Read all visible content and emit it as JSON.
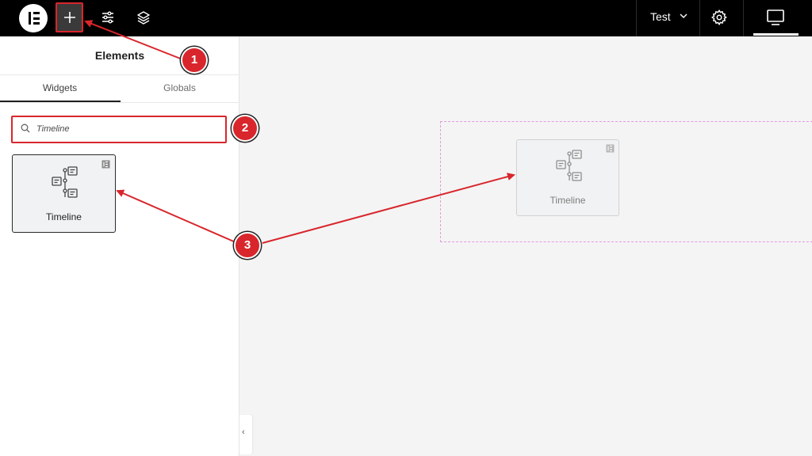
{
  "topbar": {
    "page_name": "Test",
    "icons": [
      "elementor-logo",
      "plus-icon",
      "sliders-icon",
      "layers-icon",
      "chevron-down-icon",
      "gear-icon",
      "desktop-icon"
    ]
  },
  "panel": {
    "title": "Elements",
    "tabs": [
      {
        "label": "Widgets",
        "active": true
      },
      {
        "label": "Globals",
        "active": false
      }
    ],
    "search": {
      "value": "Timeline"
    },
    "widgets": [
      {
        "label": "Timeline",
        "icon": "timeline-icon",
        "pro_badge": true
      }
    ],
    "collapse_glyph": "‹"
  },
  "canvas": {
    "dragged_widget": {
      "label": "Timeline",
      "icon": "timeline-icon"
    }
  },
  "annotations": {
    "steps": [
      "1",
      "2",
      "3"
    ],
    "color": "#d8262c"
  },
  "colors": {
    "topbar": "#000000",
    "highlight": "#d8262c",
    "dropzone_border": "#e29be0"
  }
}
